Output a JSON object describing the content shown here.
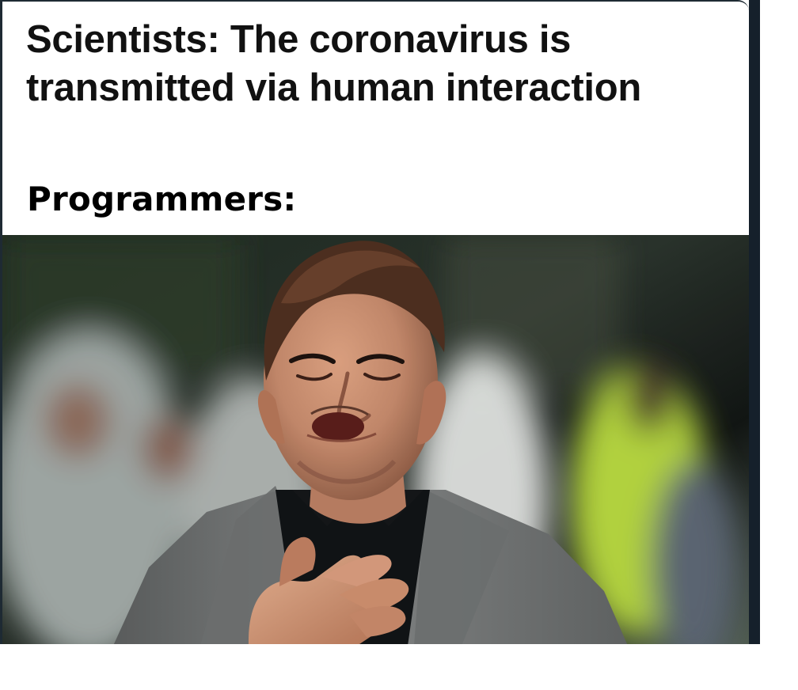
{
  "meme": {
    "headline": "Scientists: The coronavirus is transmitted via human interaction",
    "subline": "Programmers:",
    "photo": {
      "icon": "relieved-man-photo",
      "colors": {
        "background_dark": "#19231d",
        "background_gray": "#9aa29e",
        "jacket": "#7a7c7c",
        "shirt": "#111416",
        "skin": "#c98e70",
        "hair": "#4f3020",
        "safety_vest": "#b7d83f"
      }
    }
  }
}
